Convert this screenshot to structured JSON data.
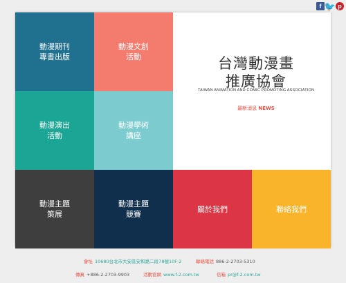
{
  "social": {
    "facebook": "f",
    "twitter": "🐦",
    "pinterest": "p"
  },
  "tiles": [
    {
      "line1": "動漫期刊",
      "line2": "專書出版",
      "color": "#207090"
    },
    {
      "line1": "動漫文創",
      "line2": "活動",
      "color": "#f47c6e"
    },
    {
      "line1": "動漫演出",
      "line2": "活動",
      "color": "#1ba594"
    },
    {
      "line1": "動漫學術",
      "line2": "講座",
      "color": "#7ccccf"
    },
    {
      "line1": "動漫主題",
      "line2": "策展",
      "color": "#3e3e3e"
    },
    {
      "line1": "動漫主題",
      "line2": "競賽",
      "color": "#102f4c"
    },
    {
      "line1": "關於我們",
      "line2": "",
      "color": "#dc3545"
    },
    {
      "line1": "聯絡我們",
      "line2": "",
      "color": "#f9b42c"
    }
  ],
  "hero": {
    "title_line1": "台灣動漫畫",
    "title_line2": "推廣協會",
    "subtitle_en": "TAIWAN ANIMATION AND COMIC PROMOTING ASSOCIATION",
    "news_label": "最新消息",
    "news_en": "NEWS"
  },
  "footer": {
    "address_label": "會址",
    "address_value": "10680台北市大安區安和路二段78號10F-2",
    "phone_label": "聯絡電話",
    "phone_value": "886-2-2703-5310",
    "fax_label": "傳真",
    "fax_value": "+886-2-2703-9903",
    "site_label": "活動官網",
    "site_value": "www.f-2.com.tw",
    "mail_label": "信箱",
    "mail_value": "pr@f-2.com.tw"
  }
}
